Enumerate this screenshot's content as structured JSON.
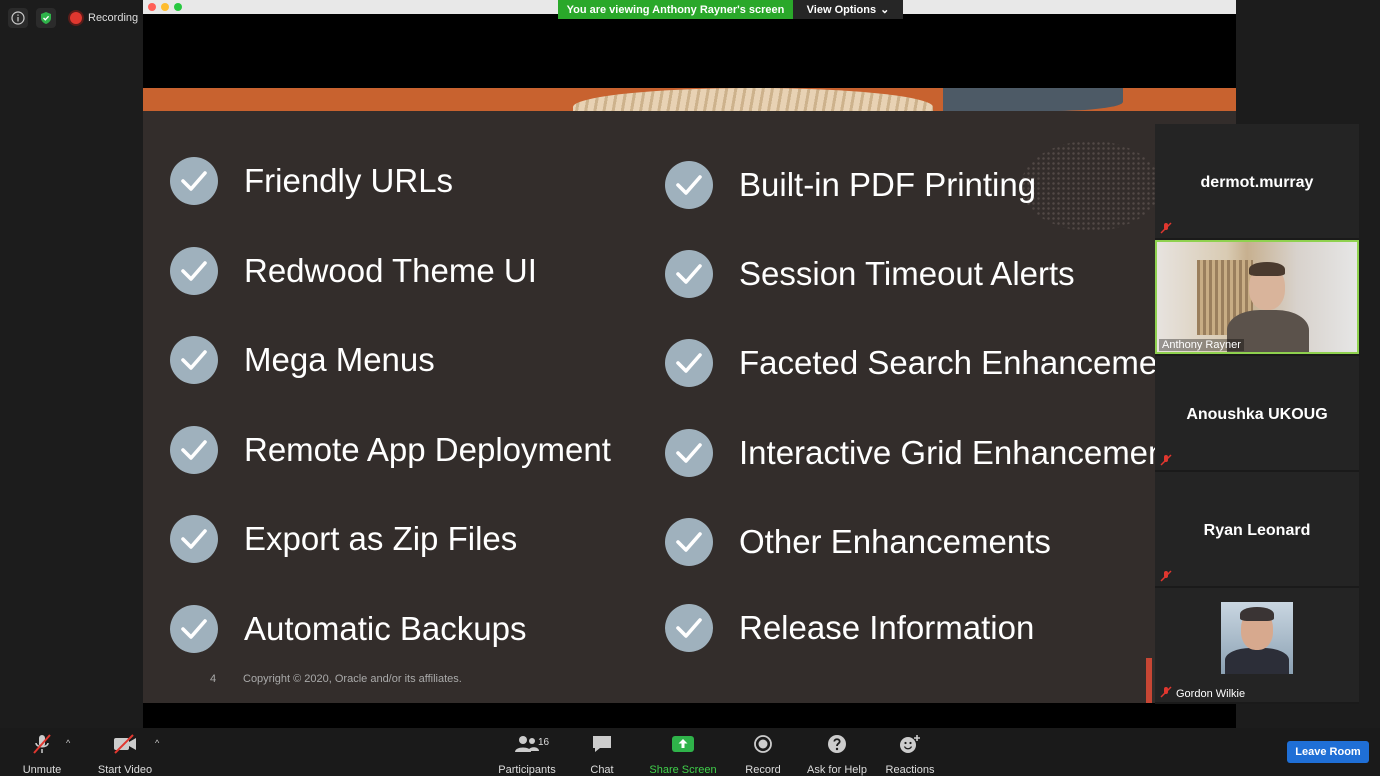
{
  "meeting": {
    "recording_label": "Recording",
    "viewing_banner": "You are viewing Anthony Rayner's screen",
    "view_options_label": "View Options",
    "view_options_chevron": "⌄"
  },
  "slide": {
    "left_items": [
      "Friendly URLs",
      "Redwood Theme UI",
      "Mega Menus",
      "Remote App Deployment",
      "Export as Zip Files",
      "Automatic Backups"
    ],
    "right_items": [
      "Built-in PDF Printing",
      "Session Timeout Alerts",
      "Faceted Search Enhancements",
      "Interactive Grid Enhancements",
      "Other Enhancements",
      "Release Information"
    ],
    "page_number": "4",
    "copyright": "Copyright © 2020, Oracle and/or its affiliates."
  },
  "participants": [
    {
      "name": "dermot.murray",
      "video": false,
      "muted": true
    },
    {
      "name": "Anthony Rayner",
      "video": true,
      "muted": false,
      "active_speaker": true
    },
    {
      "name": "Anoushka UKOUG",
      "video": false,
      "muted": true
    },
    {
      "name": "Ryan Leonard",
      "video": false,
      "muted": true
    },
    {
      "name": "Gordon Wilkie",
      "video": false,
      "muted": true,
      "photo": true
    }
  ],
  "toolbar": {
    "unmute": "Unmute",
    "start_video": "Start Video",
    "participants": "Participants",
    "participants_count": "16",
    "chat": "Chat",
    "share_screen": "Share Screen",
    "record": "Record",
    "ask_for_help": "Ask for Help",
    "reactions": "Reactions",
    "leave_room": "Leave Room"
  },
  "colors": {
    "share_green": "#3fcf4a",
    "viewing_green": "#2aa82a",
    "leave_blue": "#1f6fd6",
    "recording_red": "#e0372f",
    "slide_bg": "#332d2b",
    "check_circle": "#9fb1bd"
  },
  "icons": [
    "info-icon",
    "shield-check-icon",
    "record-icon",
    "mic-muted-icon",
    "video-off-icon",
    "participants-icon",
    "chat-icon",
    "share-screen-icon",
    "record-button-icon",
    "help-icon",
    "reactions-icon",
    "checkmark-icon"
  ]
}
